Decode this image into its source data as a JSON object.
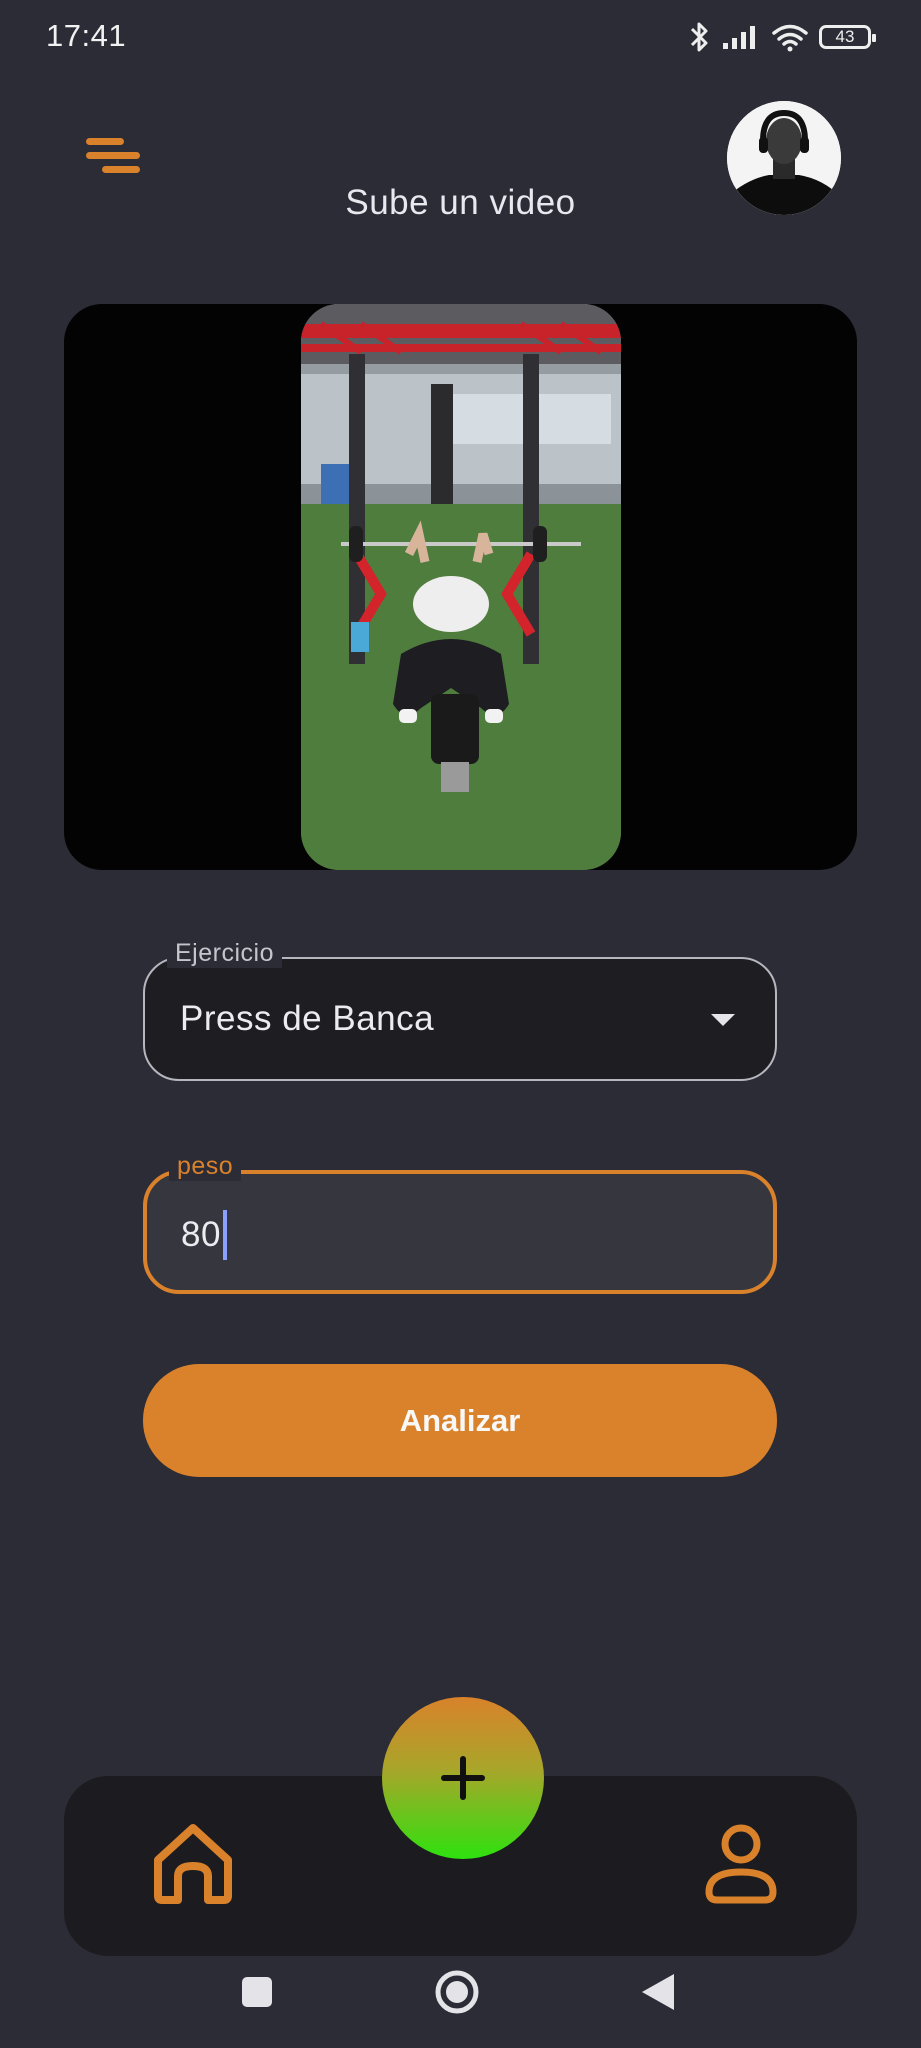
{
  "status_bar": {
    "time": "17:41",
    "battery": "43"
  },
  "header": {
    "title": "Sube un video"
  },
  "form": {
    "exercise": {
      "label": "Ejercicio",
      "value": "Press de Banca"
    },
    "weight": {
      "label": "peso",
      "value": "80"
    },
    "submit_label": "Analizar"
  },
  "colors": {
    "accent": "#d9822b",
    "background": "#2c2c37",
    "fab_gradient_end": "#2ee10f"
  },
  "icons": {
    "menu": "menu-icon",
    "home": "home-icon",
    "profile": "user-icon",
    "add": "plus-icon",
    "dropdown": "chevron-down-icon"
  }
}
